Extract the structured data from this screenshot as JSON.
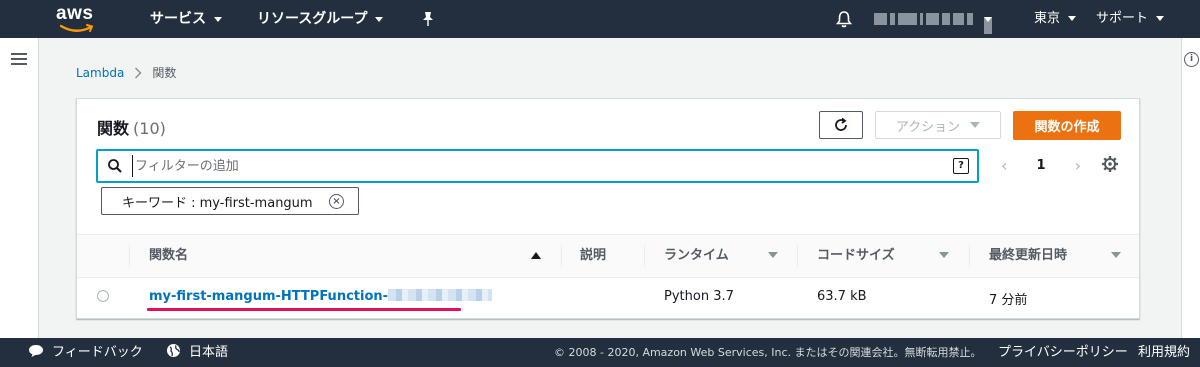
{
  "topnav": {
    "logo_text": "aws",
    "services_label": "サービス",
    "resource_groups_label": "リソースグループ",
    "region_label": "東京",
    "support_label": "サポート"
  },
  "breadcrumb": {
    "root": "Lambda",
    "current": "関数"
  },
  "panel": {
    "title": "関数",
    "count": "(10)",
    "action_label": "アクション",
    "create_label": "関数の作成",
    "filter_placeholder": "フィルターの追加",
    "help_glyph": "?",
    "page_number": "1",
    "token_text": "キーワード : my-first-mangum"
  },
  "table": {
    "columns": [
      "関数名",
      "説明",
      "ランタイム",
      "コードサイズ",
      "最終更新日時"
    ],
    "rows": [
      {
        "name": "my-first-mangum-HTTPFunction-",
        "description": "",
        "runtime": "Python 3.7",
        "code_size": "63.7 kB",
        "last_modified": "7 分前"
      }
    ]
  },
  "footer": {
    "feedback_label": "フィードバック",
    "language_label": "日本語",
    "copyright": "© 2008 - 2020, Amazon Web Services, Inc. またはその関連会社。無断転用禁止。",
    "privacy_label": "プライバシーポリシー",
    "terms_label": "利用規約"
  },
  "colors": {
    "nav_bg": "#232f3e",
    "primary_orange": "#ec7211",
    "link_blue": "#0073bb",
    "focus_cyan": "#00a1c9",
    "annotation_pink": "#e0105a"
  },
  "icons": [
    "aws-logo",
    "caret-down-icon",
    "pin-icon",
    "bell-icon",
    "hamburger-icon",
    "info-icon",
    "refresh-icon",
    "search-icon",
    "help-icon",
    "chevron-left-icon",
    "chevron-right-icon",
    "gear-icon",
    "close-circle-icon",
    "radio-icon",
    "comment-icon",
    "globe-icon"
  ]
}
